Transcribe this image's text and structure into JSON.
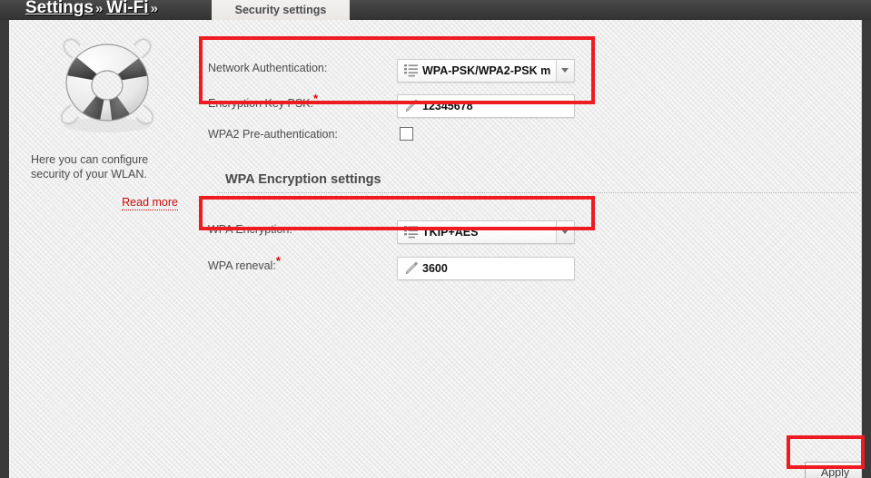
{
  "header": {
    "breadcrumbs": [
      {
        "label": "Settings",
        "separator": "»"
      },
      {
        "label": "Wi-Fi",
        "separator": "»"
      }
    ],
    "active_tab": "Security settings"
  },
  "help": {
    "icon": "lifebuoy-icon",
    "text": "Here you can configure security of your WLAN.",
    "read_more": "Read more"
  },
  "form": {
    "network_authentication": {
      "label": "Network Authentication:",
      "value": "WPA-PSK/WPA2-PSK m",
      "icon": "list-icon",
      "arrow_icon": "chevron-down-icon"
    },
    "encryption_key_psk": {
      "label": "Encryption Key PSK:",
      "required_marker": "*",
      "value": "12345678",
      "icon": "pencil-icon"
    },
    "wpa2_preauthentication": {
      "label": "WPA2 Pre-authentication:",
      "checked": false
    },
    "section_title": "WPA Encryption settings",
    "wpa_encryption": {
      "label": "WPA Encryption:",
      "value": "TKIP+AES",
      "icon": "list-icon",
      "arrow_icon": "chevron-down-icon"
    },
    "wpa_reneval": {
      "label": "WPA reneval:",
      "required_marker": "*",
      "value": "3600",
      "icon": "pencil-icon"
    }
  },
  "footer": {
    "apply_label": "Apply"
  },
  "colors": {
    "annotation_red": "#ee1c21",
    "required_red": "#e60000",
    "link_red": "#cc0a0a",
    "header_dark": "#3c3c3c"
  }
}
